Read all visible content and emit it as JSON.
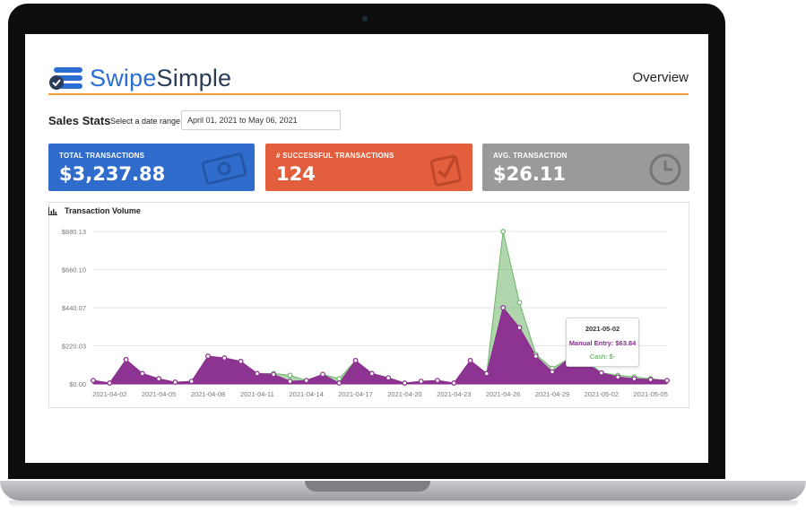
{
  "brand": {
    "name_part1": "Swipe",
    "name_part2": "Simple"
  },
  "header": {
    "title": "Overview"
  },
  "stats": {
    "title": "Sales Stats",
    "range_label": "Select a date range:",
    "range_value": "April 01, 2021 to May 06, 2021"
  },
  "cards": [
    {
      "label": "TOTAL TRANSACTIONS",
      "value": "$3,237.88",
      "icon": "money-bill-icon"
    },
    {
      "label": "# SUCCESSFUL TRANSACTIONS",
      "value": "124",
      "icon": "checkbox-icon"
    },
    {
      "label": "AVG. TRANSACTION",
      "value": "$26.11",
      "icon": "clock-icon"
    }
  ],
  "chart_panel": {
    "title": "Transaction Volume",
    "icon": "bar-chart-icon"
  },
  "tooltip": {
    "date": "2021-05-02",
    "manual": "Manual Entry: $63.84",
    "cash": "Cash: $-"
  },
  "colors": {
    "accent_rule": "#f39a3b",
    "card_total": "#2f6ccb",
    "card_success": "#e35e3c",
    "card_avg": "#9a9a9a",
    "manual_series": "#8b2a8f",
    "cash_series": "#6fb46a"
  },
  "chart_data": {
    "type": "area",
    "title": "Transaction Volume",
    "y_ticks": [
      "$880.13",
      "$660.10",
      "$440.07",
      "$220.03",
      "$0.00"
    ],
    "ylim": [
      0,
      880.13
    ],
    "x_ticks": [
      "2021-04-02",
      "2021-04-05",
      "2021-04-08",
      "2021-04-11",
      "2021-04-14",
      "2021-04-17",
      "2021-04-20",
      "2021-04-23",
      "2021-04-26",
      "2021-04-29",
      "2021-05-02",
      "2021-05-05"
    ],
    "x": [
      "2021-04-01",
      "2021-04-02",
      "2021-04-03",
      "2021-04-04",
      "2021-04-05",
      "2021-04-06",
      "2021-04-07",
      "2021-04-08",
      "2021-04-09",
      "2021-04-10",
      "2021-04-11",
      "2021-04-12",
      "2021-04-13",
      "2021-04-14",
      "2021-04-15",
      "2021-04-16",
      "2021-04-17",
      "2021-04-18",
      "2021-04-19",
      "2021-04-20",
      "2021-04-21",
      "2021-04-22",
      "2021-04-23",
      "2021-04-24",
      "2021-04-25",
      "2021-04-26",
      "2021-04-27",
      "2021-04-28",
      "2021-04-29",
      "2021-04-30",
      "2021-05-01",
      "2021-05-02",
      "2021-05-03",
      "2021-05-04",
      "2021-05-05",
      "2021-05-06"
    ],
    "series": [
      {
        "name": "Manual Entry",
        "values": [
          20,
          5,
          140,
          60,
          30,
          10,
          15,
          160,
          150,
          130,
          60,
          55,
          15,
          20,
          55,
          5,
          135,
          60,
          35,
          5,
          15,
          20,
          5,
          135,
          60,
          440,
          325,
          160,
          70,
          145,
          120,
          63.84,
          40,
          30,
          25,
          20
        ]
      },
      {
        "name": "Cash",
        "values": [
          20,
          5,
          140,
          60,
          30,
          10,
          15,
          160,
          150,
          130,
          60,
          60,
          50,
          20,
          55,
          30,
          135,
          60,
          35,
          5,
          15,
          20,
          5,
          135,
          60,
          880,
          470,
          170,
          90,
          145,
          140,
          63.84,
          50,
          40,
          30,
          20
        ]
      }
    ],
    "grid": true,
    "legend": "none"
  }
}
